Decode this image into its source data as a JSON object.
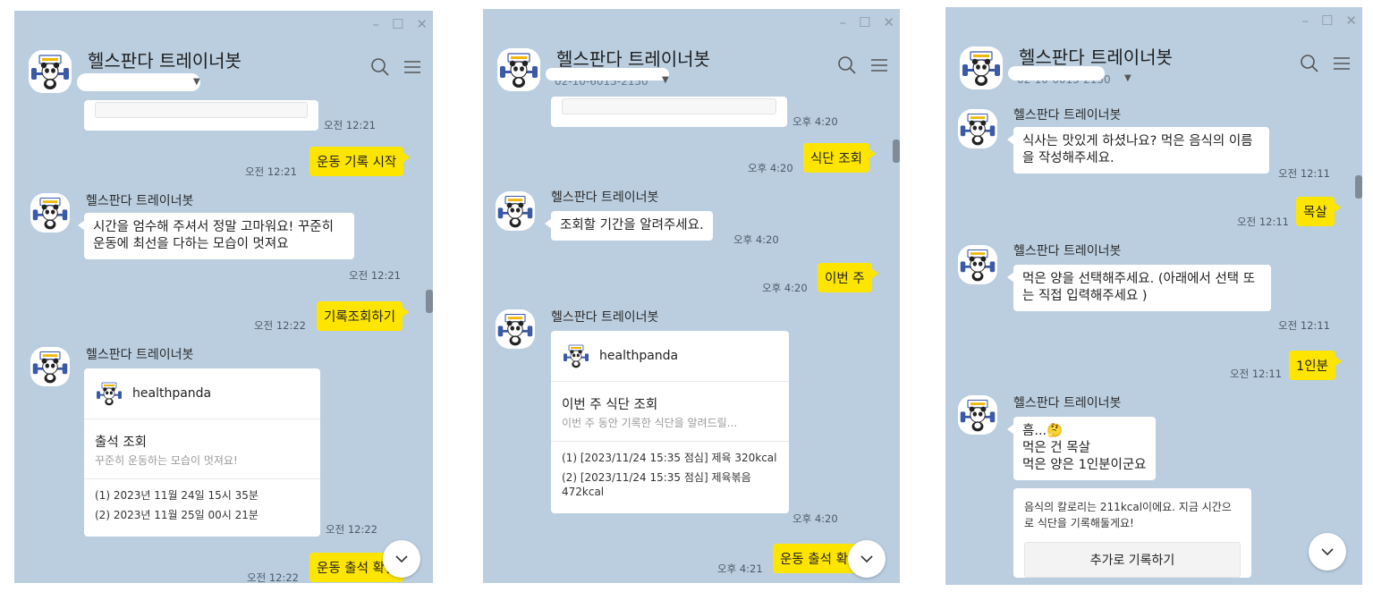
{
  "bot_name": "헬스판다 트레이너봇",
  "card_brand": "healthpanda",
  "colors": {
    "chat_bg": "#bacee0",
    "my_bubble": "#fee500",
    "bot_bubble": "#ffffff"
  },
  "icons": {
    "search": "search-icon",
    "menu": "hamburger-menu-icon",
    "scroll_down": "chevron-down-icon",
    "avatar": "panda-trainer-avatar"
  },
  "w1": {
    "time_top": "오전 12:21",
    "m1": "운동 기록 시작",
    "m1_time": "오전 12:21",
    "b1": "시간을 엄수해 주셔서 정말 고마워요! 꾸준히 운동에 최선을 다하는 모습이 멋져요",
    "b1_time": "오전 12:21",
    "m2": "기록조회하기",
    "m2_time": "오전 12:22",
    "card_title": "출석 조회",
    "card_desc": "꾸준히 운동하는 모습이 멋져요!",
    "list": [
      "(1)  2023년 11월 24일 15시 35분",
      "(2)  2023년 11월 25일 00시 21분"
    ],
    "card_time": "오전 12:22",
    "m3": "운동 출석 확인",
    "m3_time": "오전 12:22"
  },
  "w2": {
    "subtitle": "02-10-6015-2150",
    "time_top": "오후 4:20",
    "m1": "식단 조회",
    "m1_time": "오후 4:20",
    "b1": "조회할 기간을 알려주세요.",
    "b1_time": "오후 4:20",
    "m2": "이번 주",
    "m2_time": "오후 4:20",
    "card_title": "이번 주 식단 조회",
    "card_desc": "이번 주 동안 기록한 식단을 알려드릴...",
    "list": [
      "(1)  [2023/11/24 15:35 점심] 제육 320kcal",
      "(2)  [2023/11/24 15:35 점심] 제육볶음 472kcal"
    ],
    "card_time": "오후 4:20",
    "m3": "운동 출석 확인",
    "m3_time": "오후 4:21"
  },
  "w3": {
    "subtitle": "02-10-6015-2150",
    "b1": "식사는 맛있게 하셨나요? 먹은 음식의 이름을 작성해주세요.",
    "b1_time": "오전 12:11",
    "m1": "목살",
    "m1_time": "오전 12:11",
    "b2": "먹은 양을 선택해주세요. (아래에서 선택 또는 직접 입력해주세요 )",
    "b2_time": "오전 12:11",
    "m2": "1인분",
    "m2_time": "오전 12:11",
    "b3_l1": "흠...🤔",
    "b3_l2": "먹은 건 목살",
    "b3_l3": "먹은 양은 1인분이군요",
    "b4": "음식의 칼로리는  211kcal이에요. 지금 시간으로 식단을 기록해둘게요!",
    "btn": "추가로 기록하기"
  }
}
